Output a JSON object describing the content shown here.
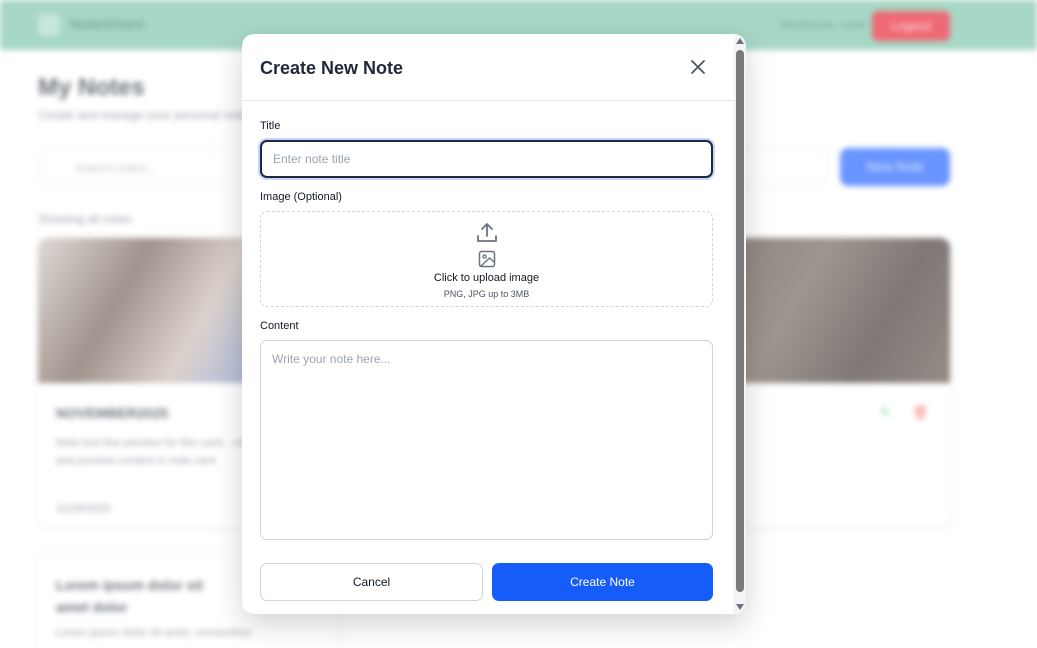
{
  "background": {
    "brand": "NoteShare",
    "welcome": "Welcome, user",
    "logout_label": "Logout",
    "page_title": "My Notes",
    "page_subtitle": "Create and manage your personal notes",
    "search_placeholder": "Search notes...",
    "new_note_label": "New Note",
    "count_text": "Showing all notes",
    "cards": [
      {
        "title": "NOVEMBER2025",
        "text": "Note text line preview for this card... more text here and preview content in note card",
        "date": "11/29/2025"
      },
      {
        "title": "Lorem ipsum dolor sit amet dolor",
        "text": "Lorem ipsum dolor sit amet, consectetur",
        "date": ""
      }
    ],
    "colors": {
      "header": "#79c2a6",
      "accent": "#1a5cff",
      "danger": "#e6192c"
    }
  },
  "modal": {
    "title": "Create New Note",
    "close_icon": "close-icon",
    "title_label": "Title",
    "title_placeholder": "Enter note title",
    "title_value": "",
    "image_label": "Image (Optional)",
    "upload_icon": "upload-icon",
    "image_icon": "image-icon",
    "upload_text": "Click to upload image",
    "upload_hint": "PNG, JPG up to 3MB",
    "content_label": "Content",
    "content_placeholder": "Write your note here...",
    "content_value": "",
    "cancel_label": "Cancel",
    "create_label": "Create Note",
    "colors": {
      "primary": "#155cf8",
      "text": "#1f2937",
      "border": "#d1d5db"
    }
  }
}
